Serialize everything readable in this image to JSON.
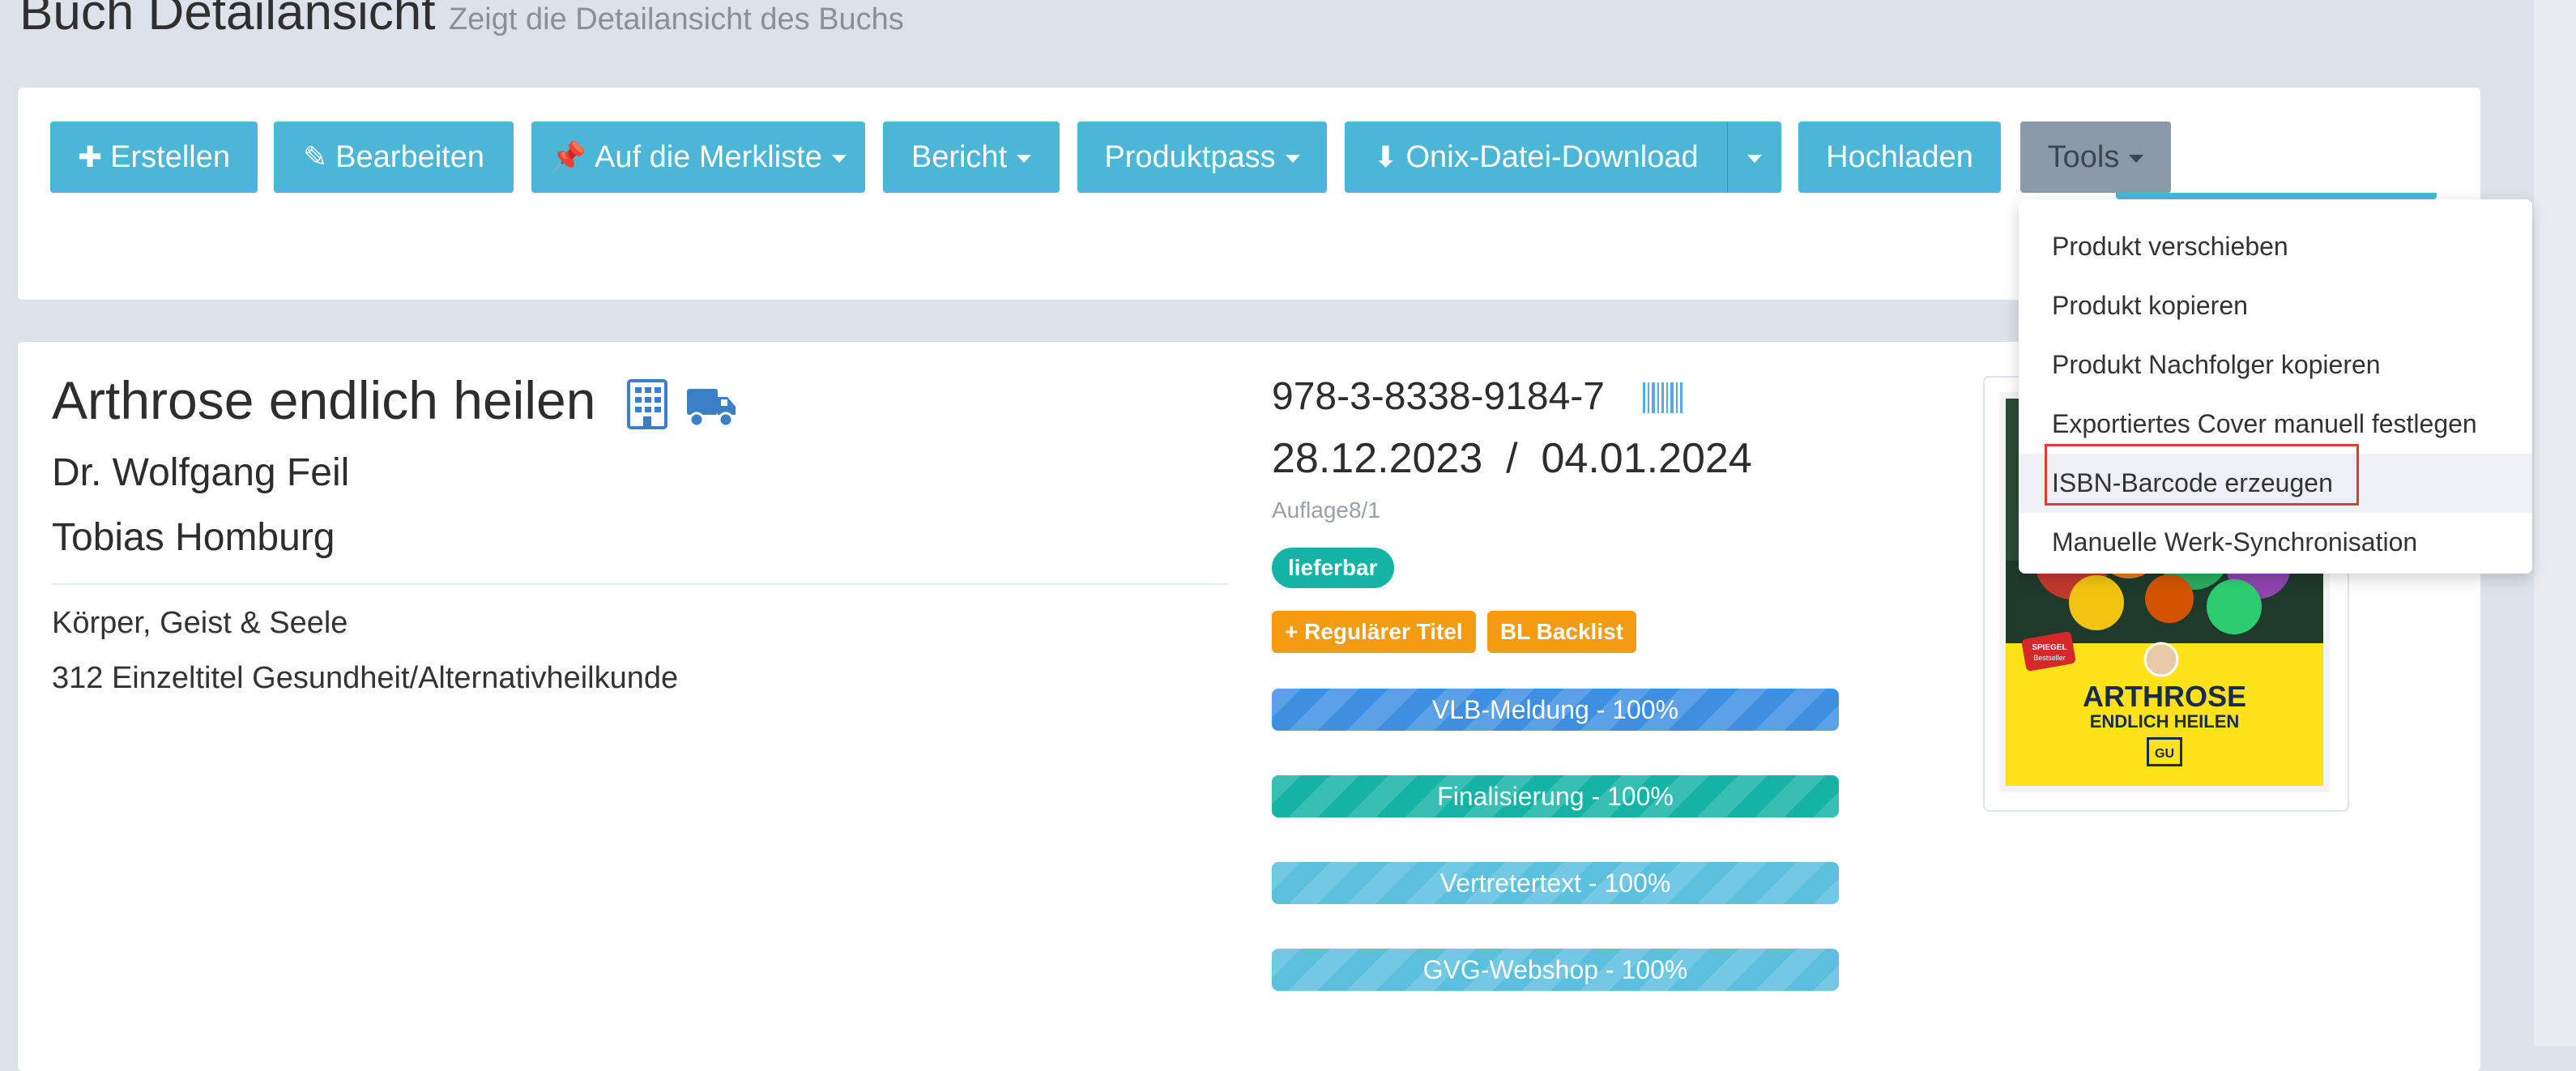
{
  "header": {
    "title": "Buch Detailansicht",
    "subtitle": "Zeigt die Detailansicht des Buchs"
  },
  "toolbar": {
    "create": "Erstellen",
    "edit": "Bearbeiten",
    "watchlist": "Auf die Merkliste",
    "report": "Bericht",
    "product_pass": "Produktpass",
    "onix_download": "Onix-Datei-Download",
    "upload": "Hochladen",
    "tools": "Tools"
  },
  "tools_menu": {
    "items": [
      "Produkt verschieben",
      "Produkt kopieren",
      "Produkt Nachfolger kopieren",
      "Exportiertes Cover manuell festlegen",
      "ISBN-Barcode erzeugen",
      "Manuelle Werk-Synchronisation"
    ],
    "active_index": 4
  },
  "book": {
    "title": "Arthrose endlich heilen",
    "authors": [
      "Dr. Wolfgang Feil",
      "Tobias Homburg"
    ],
    "category": "Körper, Geist & Seele",
    "genre_line": "312 Einzeltitel Gesundheit/Alternativheilkunde",
    "isbn": "978-3-8338-9184-7",
    "dates": "28.12.2023  /  04.01.2024",
    "edition": "Auflage8/1",
    "status": "lieferbar",
    "labels": [
      "+ Regulärer Titel",
      "BL Backlist"
    ],
    "progress": [
      {
        "label": "VLB-Meldung - 100%",
        "value": 100,
        "color": "#3f8fe0"
      },
      {
        "label": "Finalisierung - 100%",
        "value": 100,
        "color": "#15b3a4"
      },
      {
        "label": "Vertretertext - 100%",
        "value": 100,
        "color": "#5bbfde"
      },
      {
        "label": "GVG-Webshop - 100%",
        "value": 100,
        "color": "#5bbfde"
      }
    ]
  },
  "cover": {
    "title_line1": "ARTHROSE",
    "title_line2": "ENDLICH HEILEN",
    "publisher": "GU",
    "badge_line1": "SPIEGEL",
    "badge_line2": "Bestseller"
  },
  "icons": {
    "create": "plus-icon",
    "edit": "pencil-icon",
    "watchlist": "pin-icon",
    "onix": "download-icon",
    "building": "building-icon",
    "truck": "truck-icon",
    "barcode": "barcode-icon"
  }
}
